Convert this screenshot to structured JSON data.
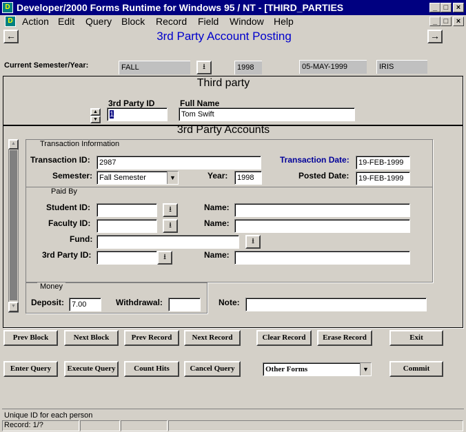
{
  "window": {
    "title": "Developer/2000 Forms Runtime for Windows 95 / NT - [THIRD_PARTIES",
    "icon": "app-icon",
    "minimize": "_",
    "maximize": "□",
    "close": "×",
    "restore": "🗗"
  },
  "menu": [
    "Action",
    "Edit",
    "Query",
    "Block",
    "Record",
    "Field",
    "Window",
    "Help"
  ],
  "form": {
    "title": "3rd Party Account Posting",
    "prev_arrow": "←",
    "next_arrow": "→"
  },
  "header": {
    "semester_label": "Current Semester/Year:",
    "semester_value": "FALL",
    "year_value": "1998",
    "date_value": "05-MAY-1999",
    "user_value": "IRIS"
  },
  "third_party": {
    "block_title": "Third party",
    "id_label": "3rd Party ID",
    "id_value": "1",
    "name_label": "Full Name",
    "name_value": "Tom Swift"
  },
  "accounts": {
    "block_title": "3rd Party Accounts",
    "transaction_frame": "Transaction Information",
    "transaction_id_label": "Transaction ID:",
    "transaction_id_value": "2987",
    "transaction_date_label": "Transaction Date:",
    "transaction_date_value": "19-FEB-1999",
    "semester_label": "Semester:",
    "semester_value": "Fall Semester",
    "year_label": "Year:",
    "year_value": "1998",
    "posted_date_label": "Posted Date:",
    "posted_date_value": "19-FEB-1999",
    "paid_by_frame": "Paid By",
    "student_id_label": "Student ID:",
    "faculty_id_label": "Faculty ID:",
    "fund_label": "Fund:",
    "third_party_id_label": "3rd Party ID:",
    "name_label": "Name:",
    "money_frame": "Money",
    "deposit_label": "Deposit:",
    "deposit_value": "7.00",
    "withdrawal_label": "Withdrawal:",
    "note_label": "Note:"
  },
  "buttons": {
    "prev_block": "Prev Block",
    "next_block": "Next Block",
    "prev_record": "Prev Record",
    "next_record": "Next Record",
    "clear_record": "Clear Record",
    "erase_record": "Erase Record",
    "exit": "Exit",
    "enter_query": "Enter Query",
    "execute_query": "Execute Query",
    "count_hits": "Count Hits",
    "cancel_query": "Cancel Query",
    "other_forms": "Other Forms",
    "commit": "Commit"
  },
  "status": {
    "hint": "Unique ID for each person",
    "record": "Record: 1/?"
  },
  "glyphs": {
    "list_arrow": "⭳",
    "combo_arrow": "▼",
    "scroll_up": "▲",
    "scroll_down": "▼",
    "spin_up": "▲",
    "spin_down": "▼"
  }
}
